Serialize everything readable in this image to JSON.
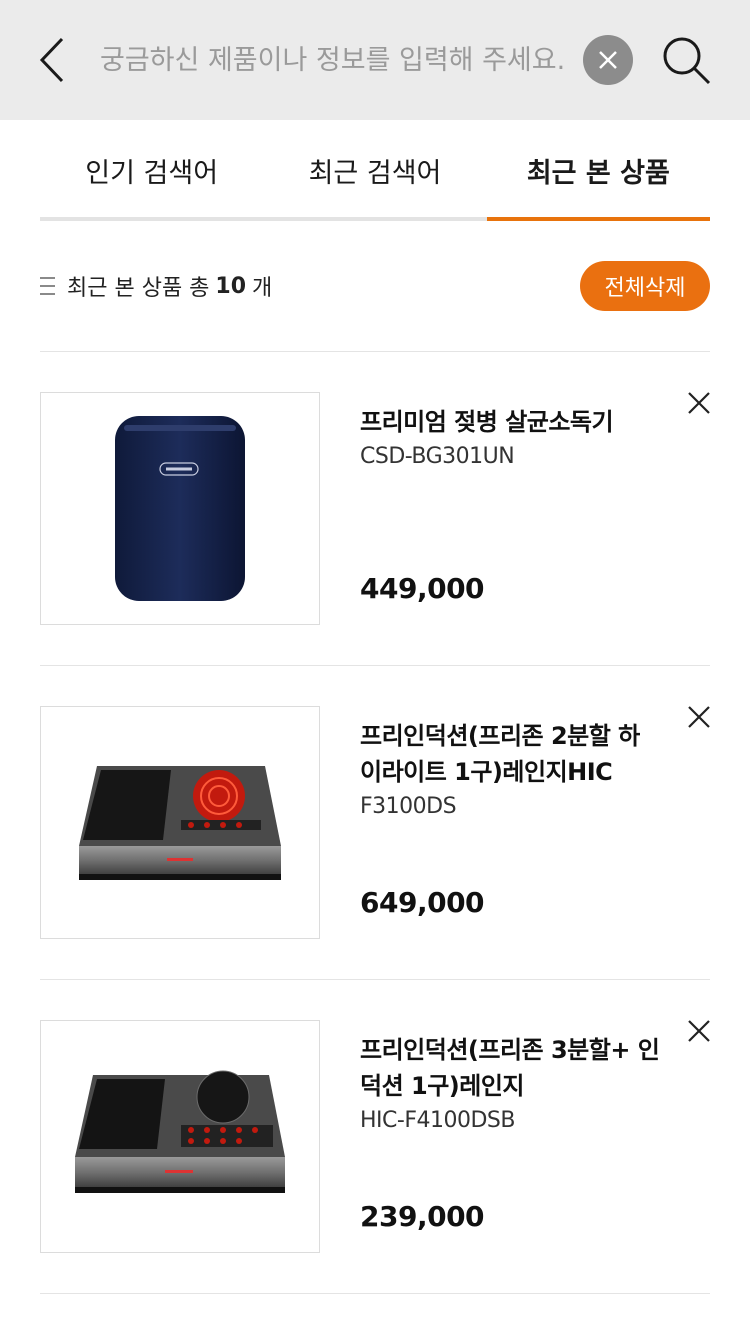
{
  "search": {
    "placeholder": "궁금하신 제품이나 정보를 입력해 주세요.",
    "value": ""
  },
  "tabs": [
    {
      "label": "인기 검색어",
      "active": false
    },
    {
      "label": "최근 검색어",
      "active": false
    },
    {
      "label": "최근 본 상품",
      "active": true
    }
  ],
  "summary": {
    "prefix": "최근 본 상품 총",
    "count": "10",
    "suffix": "개",
    "delete_all_label": "전체삭제"
  },
  "colors": {
    "accent": "#ea7010",
    "header_bg": "#ebebeb",
    "clear_button": "#8c8c8c"
  },
  "products": [
    {
      "name": "프리미엄 젖병 살균소독기",
      "model": "CSD-BG301UN",
      "price": "449,000",
      "image": "bottle-sterilizer-image"
    },
    {
      "name": "프리인덕션(프리존 2분할 하이라이트 1구)레인지HIC",
      "model": "F3100DS",
      "price": "649,000",
      "image": "induction-range-image"
    },
    {
      "name": "프리인덕션(프리존 3분할+ 인덕션 1구)레인지",
      "model": "HIC-F4100DSB",
      "price": "239,000",
      "image": "induction-range-image"
    }
  ]
}
